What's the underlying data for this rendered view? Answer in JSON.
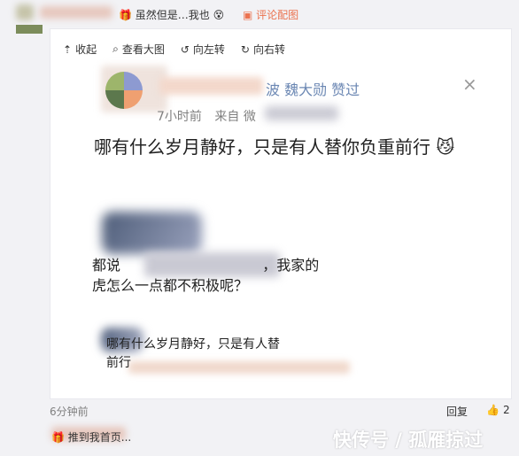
{
  "top_row": {
    "reply_text": "虽然但是…我也",
    "icon": "emoji-face",
    "comment_label": "评论配图"
  },
  "toolbar": {
    "collapse_label": "收起",
    "view_large_label": "查看大图",
    "rotate_left_label": "向左转",
    "rotate_right_label": "向右转"
  },
  "post": {
    "like_notice": "波 魏大勋 赞过",
    "time_label": "7小时前",
    "from_label": "来自 微",
    "text": "哪有什么岁月静好，只是有人替你负重前行"
  },
  "quotes": {
    "quote1": "都说",
    "quote1_tail": "，我家的",
    "quote2": "虎怎么一点都不积极呢？",
    "quote3": "哪有什么岁月静好，只是有人替",
    "quote4": "前行"
  },
  "footer": {
    "time": "6分钟前",
    "reply_label": "回复",
    "like_count": "2"
  },
  "bottom": {
    "text": "推到我首页..."
  },
  "watermark": {
    "text": "快传号 / 孤雁掠过"
  }
}
